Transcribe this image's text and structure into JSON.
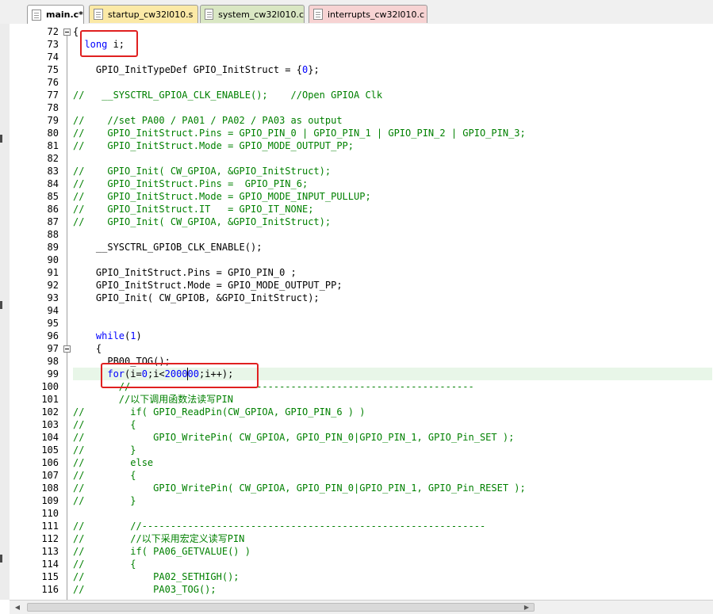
{
  "tabs": [
    {
      "label": "main.c*",
      "active": true,
      "color": "#ffffff"
    },
    {
      "label": "startup_cw32l010.s",
      "active": false,
      "color": "#fbe9a6"
    },
    {
      "label": "system_cw32l010.c",
      "active": false,
      "color": "#d9e7c3"
    },
    {
      "label": "interrupts_cw32l010.c",
      "active": false,
      "color": "#f7d3d3"
    }
  ],
  "editor": {
    "lines": [
      {
        "n": "72",
        "segs": [
          {
            "t": "{"
          }
        ]
      },
      {
        "n": "73",
        "segs": [
          {
            "t": "  "
          },
          {
            "t": "long",
            "c": "kw"
          },
          {
            "t": " i;"
          }
        ]
      },
      {
        "n": "74",
        "segs": []
      },
      {
        "n": "75",
        "segs": [
          {
            "t": "    GPIO_InitTypeDef GPIO_InitStruct = {"
          },
          {
            "t": "0",
            "c": "num"
          },
          {
            "t": "};"
          }
        ]
      },
      {
        "n": "76",
        "segs": []
      },
      {
        "n": "77",
        "segs": [
          {
            "t": "//   __SYSCTRL_GPIOA_CLK_ENABLE();    //Open GPIOA Clk",
            "c": "cm"
          }
        ]
      },
      {
        "n": "78",
        "segs": []
      },
      {
        "n": "79",
        "segs": [
          {
            "t": "//    //set PA00 / PA01 / PA02 / PA03 as output",
            "c": "cm"
          }
        ]
      },
      {
        "n": "80",
        "segs": [
          {
            "t": "//    GPIO_InitStruct.Pins = GPIO_PIN_0 | GPIO_PIN_1 | GPIO_PIN_2 | GPIO_PIN_3;",
            "c": "cm"
          }
        ]
      },
      {
        "n": "81",
        "segs": [
          {
            "t": "//    GPIO_InitStruct.Mode = GPIO_MODE_OUTPUT_PP;",
            "c": "cm"
          }
        ]
      },
      {
        "n": "82",
        "segs": []
      },
      {
        "n": "83",
        "segs": [
          {
            "t": "//    GPIO_Init( CW_GPIOA, &GPIO_InitStruct);",
            "c": "cm"
          }
        ]
      },
      {
        "n": "84",
        "segs": [
          {
            "t": "//    GPIO_InitStruct.Pins =  GPIO_PIN_6;",
            "c": "cm"
          }
        ]
      },
      {
        "n": "85",
        "segs": [
          {
            "t": "//    GPIO_InitStruct.Mode = GPIO_MODE_INPUT_PULLUP;",
            "c": "cm"
          }
        ]
      },
      {
        "n": "86",
        "segs": [
          {
            "t": "//    GPIO_InitStruct.IT   = GPIO_IT_NONE;",
            "c": "cm"
          }
        ]
      },
      {
        "n": "87",
        "segs": [
          {
            "t": "//    GPIO_Init( CW_GPIOA, &GPIO_InitStruct);",
            "c": "cm"
          }
        ]
      },
      {
        "n": "88",
        "segs": []
      },
      {
        "n": "89",
        "segs": [
          {
            "t": "    __SYSCTRL_GPIOB_CLK_ENABLE();"
          }
        ]
      },
      {
        "n": "90",
        "segs": []
      },
      {
        "n": "91",
        "segs": [
          {
            "t": "    GPIO_InitStruct.Pins = GPIO_PIN_0 ;"
          }
        ]
      },
      {
        "n": "92",
        "segs": [
          {
            "t": "    GPIO_InitStruct.Mode = GPIO_MODE_OUTPUT_PP;"
          }
        ]
      },
      {
        "n": "93",
        "segs": [
          {
            "t": "    GPIO_Init( CW_GPIOB, &GPIO_InitStruct);"
          }
        ]
      },
      {
        "n": "94",
        "segs": []
      },
      {
        "n": "95",
        "segs": []
      },
      {
        "n": "96",
        "segs": [
          {
            "t": "    "
          },
          {
            "t": "while",
            "c": "kw"
          },
          {
            "t": "("
          },
          {
            "t": "1",
            "c": "num"
          },
          {
            "t": ")"
          }
        ]
      },
      {
        "n": "97",
        "segs": [
          {
            "t": "    {"
          }
        ]
      },
      {
        "n": "98",
        "segs": [
          {
            "t": "      PB00_TOG();"
          }
        ]
      },
      {
        "n": "99",
        "segs": [
          {
            "t": "      "
          },
          {
            "t": "for",
            "c": "kw"
          },
          {
            "t": "(i="
          },
          {
            "t": "0",
            "c": "num"
          },
          {
            "t": ";i<"
          },
          {
            "t": "200000",
            "c": "num"
          },
          {
            "t": ";i++);"
          }
        ]
      },
      {
        "n": "100",
        "segs": [
          {
            "t": "        //------------------------------------------------------------",
            "c": "cm"
          }
        ]
      },
      {
        "n": "101",
        "segs": [
          {
            "t": "        //以下调用函数法读写PIN",
            "c": "cm"
          }
        ]
      },
      {
        "n": "102",
        "segs": [
          {
            "t": "//        if( GPIO_ReadPin(CW_GPIOA, GPIO_PIN_6 ) )",
            "c": "cm"
          }
        ]
      },
      {
        "n": "103",
        "segs": [
          {
            "t": "//        {",
            "c": "cm"
          }
        ]
      },
      {
        "n": "104",
        "segs": [
          {
            "t": "//            GPIO_WritePin( CW_GPIOA, GPIO_PIN_0|GPIO_PIN_1, GPIO_Pin_SET );",
            "c": "cm"
          }
        ]
      },
      {
        "n": "105",
        "segs": [
          {
            "t": "//        }",
            "c": "cm"
          }
        ]
      },
      {
        "n": "106",
        "segs": [
          {
            "t": "//        else",
            "c": "cm"
          }
        ]
      },
      {
        "n": "107",
        "segs": [
          {
            "t": "//        {",
            "c": "cm"
          }
        ]
      },
      {
        "n": "108",
        "segs": [
          {
            "t": "//            GPIO_WritePin( CW_GPIOA, GPIO_PIN_0|GPIO_PIN_1, GPIO_Pin_RESET );",
            "c": "cm"
          }
        ]
      },
      {
        "n": "109",
        "segs": [
          {
            "t": "//        }",
            "c": "cm"
          }
        ]
      },
      {
        "n": "110",
        "segs": []
      },
      {
        "n": "111",
        "segs": [
          {
            "t": "//        //------------------------------------------------------------",
            "c": "cm"
          }
        ]
      },
      {
        "n": "112",
        "segs": [
          {
            "t": "//        //以下采用宏定义读写PIN",
            "c": "cm"
          }
        ]
      },
      {
        "n": "113",
        "segs": [
          {
            "t": "//        if( PA06_GETVALUE() )",
            "c": "cm"
          }
        ]
      },
      {
        "n": "114",
        "segs": [
          {
            "t": "//        {",
            "c": "cm"
          }
        ]
      },
      {
        "n": "115",
        "segs": [
          {
            "t": "//            PA02_SETHIGH();",
            "c": "cm"
          }
        ]
      },
      {
        "n": "116",
        "segs": [
          {
            "t": "//            PA03_TOG();",
            "c": "cm"
          }
        ]
      }
    ]
  },
  "colors": {
    "keyword": "#0000ff",
    "comment": "#008000",
    "highlight_box": "#e02020",
    "current_line": "#e8f6e8"
  }
}
